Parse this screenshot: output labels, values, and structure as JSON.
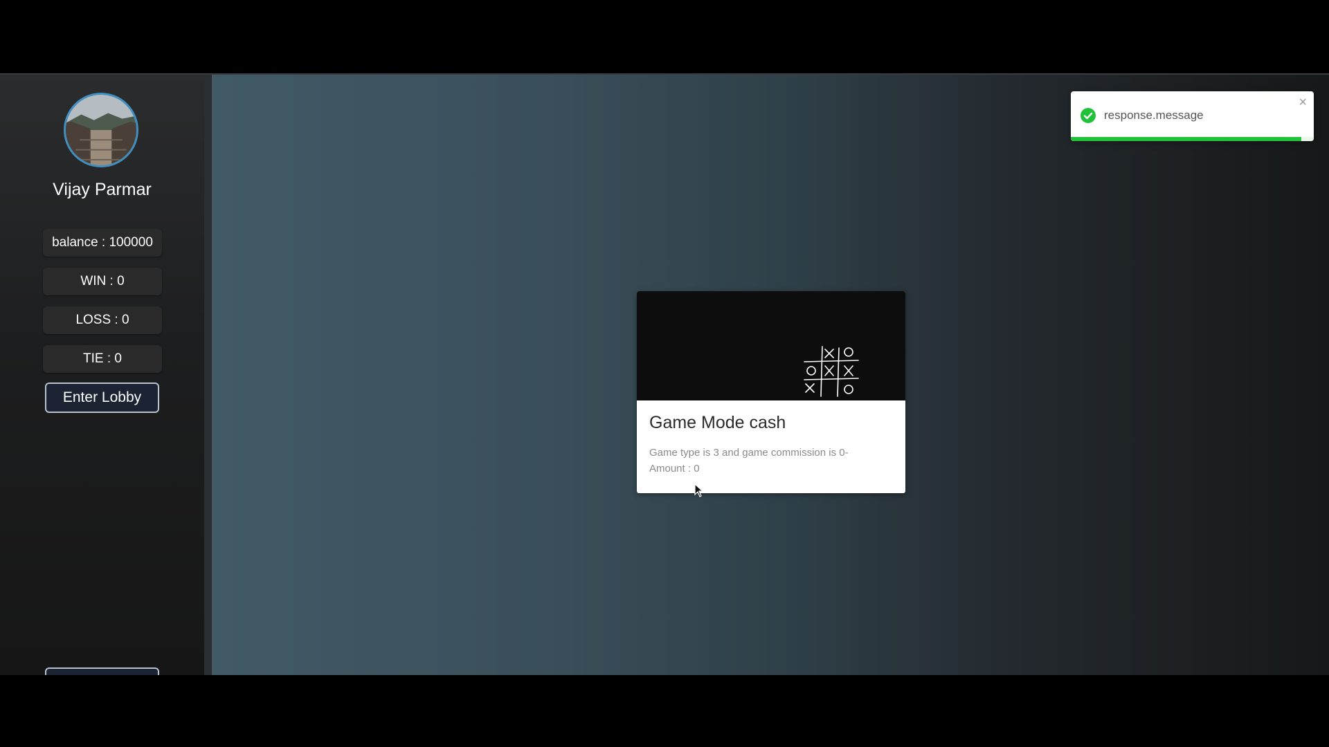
{
  "user": {
    "name": "Vijay Parmar",
    "avatar": "avatar-photo"
  },
  "stats": {
    "balance": "balance : 100000",
    "win": "WIN : 0",
    "loss": "LOSS : 0",
    "tie": "TIE : 0"
  },
  "buttons": {
    "enter_lobby": "Enter Lobby"
  },
  "game_card": {
    "title": "Game Mode cash",
    "description": "Game type is 3 and game commission is 0-",
    "amount": "Amount : 0",
    "image_icon": "tic-tac-toe-icon"
  },
  "toast": {
    "message": "response.message",
    "close_label": "×",
    "progress": 0.95,
    "status_color": "#22c13a",
    "icon": "check-circle-icon"
  }
}
